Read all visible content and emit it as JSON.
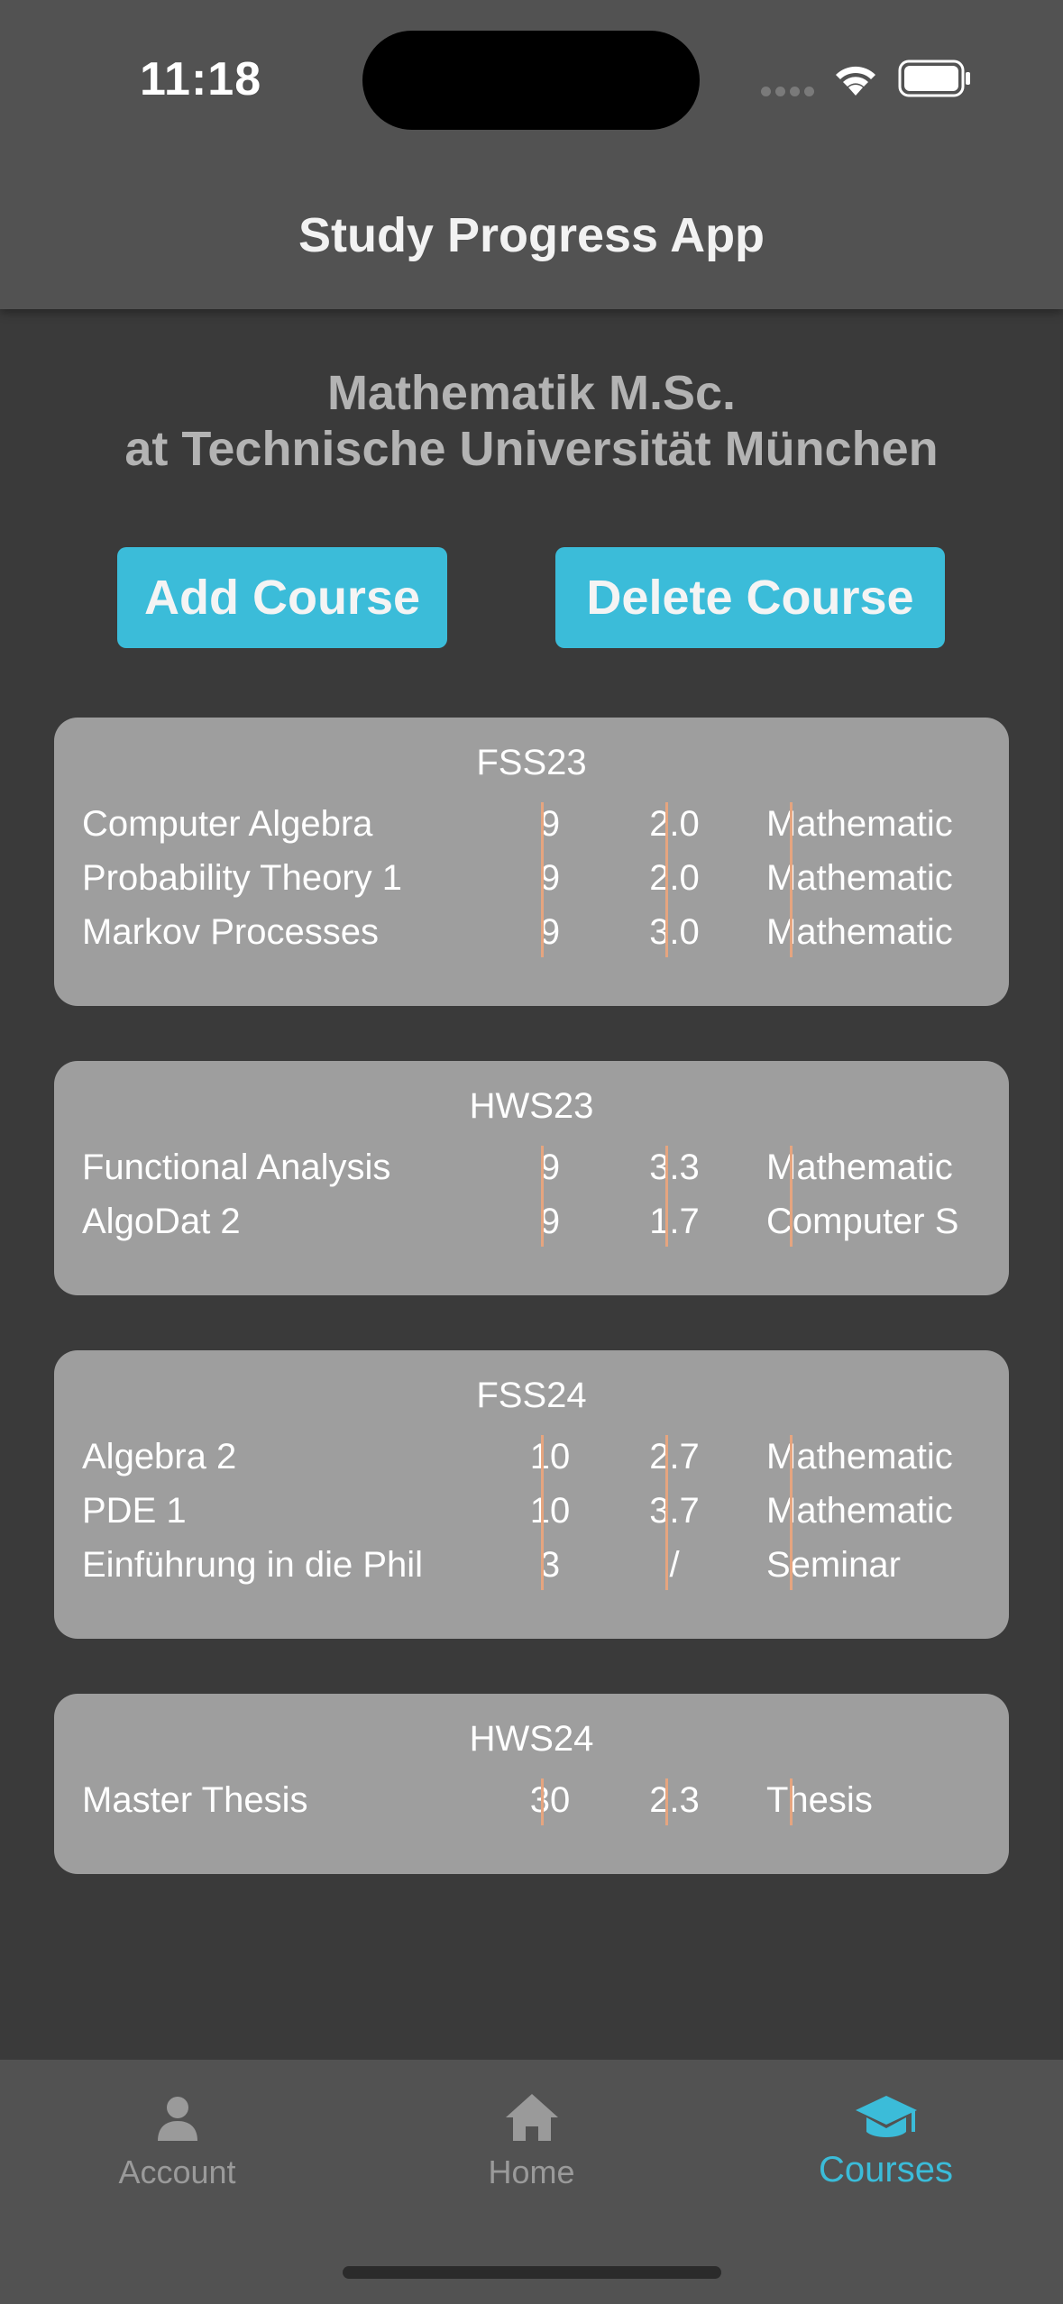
{
  "status_bar": {
    "time": "11:18"
  },
  "header": {
    "title": "Study Progress App"
  },
  "program": {
    "line1": "Mathematik M.Sc.",
    "line2": "at Technische Universität München"
  },
  "actions": {
    "add_label": "Add Course",
    "delete_label": "Delete Course"
  },
  "semesters": [
    {
      "name": "FSS23",
      "courses": [
        {
          "name": "Computer Algebra",
          "ects": "9",
          "grade": "2.0",
          "type": "Mathematic"
        },
        {
          "name": "Probability Theory 1",
          "ects": "9",
          "grade": "2.0",
          "type": "Mathematic"
        },
        {
          "name": "Markov Processes",
          "ects": "9",
          "grade": "3.0",
          "type": "Mathematic"
        }
      ]
    },
    {
      "name": "HWS23",
      "courses": [
        {
          "name": "Functional Analysis",
          "ects": "9",
          "grade": "3.3",
          "type": "Mathematic"
        },
        {
          "name": "AlgoDat 2",
          "ects": "9",
          "grade": "1.7",
          "type": "Computer S"
        }
      ]
    },
    {
      "name": "FSS24",
      "courses": [
        {
          "name": "Algebra 2",
          "ects": "10",
          "grade": "2.7",
          "type": "Mathematic"
        },
        {
          "name": "PDE 1",
          "ects": "10",
          "grade": "3.7",
          "type": "Mathematic"
        },
        {
          "name": "Einführung in die Phil",
          "ects": "3",
          "grade": "/",
          "type": "Seminar"
        }
      ]
    },
    {
      "name": "HWS24",
      "courses": [
        {
          "name": "Master Thesis",
          "ects": "30",
          "grade": "2.3",
          "type": "Thesis"
        }
      ]
    }
  ],
  "nav": {
    "items": [
      {
        "label": "Account",
        "icon": "person-icon"
      },
      {
        "label": "Home",
        "icon": "home-icon"
      },
      {
        "label": "Courses",
        "icon": "graduation-cap-icon"
      }
    ],
    "active": "Courses"
  },
  "colors": {
    "accent": "#3bbcd9",
    "card": "#9e9e9e",
    "divider": "#e6a57f"
  }
}
